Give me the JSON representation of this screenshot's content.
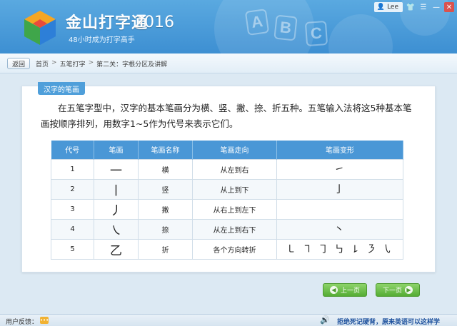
{
  "app": {
    "title": "金山打字通",
    "year": "2016",
    "slogan": "48小时成为打字高手",
    "decor_letters": [
      "A",
      "B",
      "C"
    ]
  },
  "user": {
    "name": "Lee",
    "icons": [
      "user-icon",
      "shirt-icon",
      "menu-icon",
      "minimize-icon",
      "close-icon"
    ]
  },
  "breadcrumb": {
    "back": "返回",
    "items": [
      "首页",
      "五笔打字",
      "第二关：字根分区及讲解"
    ],
    "separator": ">"
  },
  "panel": {
    "tag": "汉字的笔画",
    "intro": "在五笔字型中，汉字的基本笔画分为横、竖、撇、捺、折五种。五笔输入法将这5种基本笔画按顺序排列，用数字1~5作为代号来表示它们。"
  },
  "table": {
    "headers": [
      "代号",
      "笔画",
      "笔画名称",
      "笔画走向",
      "笔画变形"
    ],
    "rows": [
      [
        "1",
        "一",
        "横",
        "从左到右",
        "㇀"
      ],
      [
        "2",
        "丨",
        "竖",
        "从上到下",
        "亅"
      ],
      [
        "3",
        "丿",
        "撇",
        "从右上到左下",
        ""
      ],
      [
        "4",
        "㇏",
        "捺",
        "从左上到右下",
        "丶"
      ],
      [
        "5",
        "乙",
        "折",
        "各个方向转折",
        "㇄ ㇕ ㇆ ㇉ ㇙ ㇋ ㇂"
      ]
    ]
  },
  "nav": {
    "prev": "上一页",
    "next": "下一页"
  },
  "footer": {
    "feedback": "用户反馈：",
    "motto": "拒绝死记硬背，原来英语可以这样学"
  },
  "colors": {
    "header": "#3d8fd2",
    "table_header": "#4a97d6",
    "button_green": "#55ad34",
    "motto": "#1b4f9c"
  }
}
